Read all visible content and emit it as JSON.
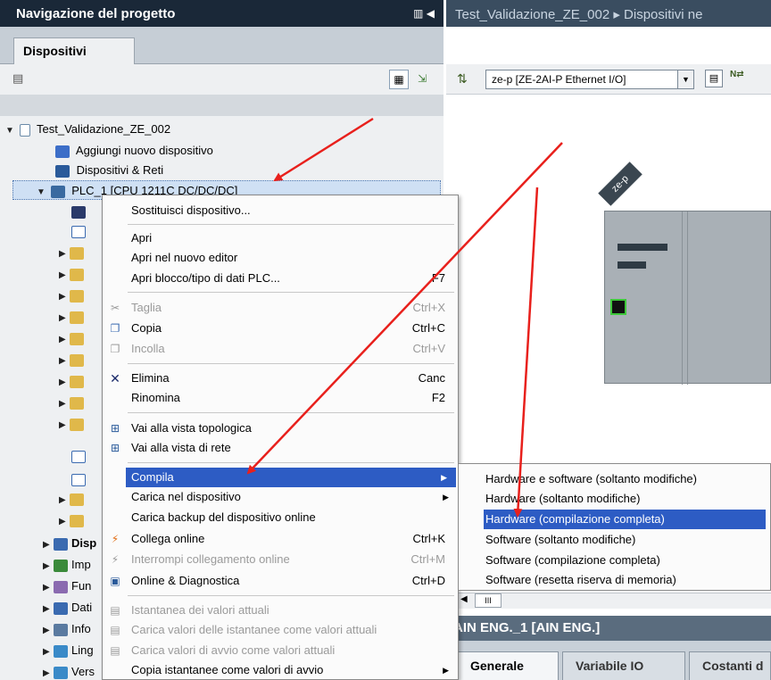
{
  "nav": {
    "title": "Navigazione del progetto",
    "tab": "Dispositivi"
  },
  "tree": {
    "project": "Test_Validazione_ZE_002",
    "add_device": "Aggiungi nuovo dispositivo",
    "devices_networks": "Dispositivi & Reti",
    "plc": "PLC_1 [CPU 1211C DC/DC/DC]",
    "bottom_items": [
      "Disp",
      "Imp",
      "Fun",
      "Dati",
      "Info",
      "Ling",
      "Vers"
    ]
  },
  "editor": {
    "breadcrumb": "Test_Validazione_ZE_002 ▸ Dispositivi ne",
    "device_select": "ze-p [ZE-2AI-P Ethernet I/O]",
    "device_tag": "ze-p",
    "scroll_mark": "III",
    "inspector_title": "AIN ENG._1 [AIN ENG.]",
    "inspector_tabs": [
      "Generale",
      "Variabile IO",
      "Costanti d"
    ]
  },
  "context_menu": {
    "items": [
      {
        "label": "Sostituisci dispositivo...",
        "key": "",
        "disabled": false
      },
      {
        "label": "Apri",
        "key": "",
        "disabled": false
      },
      {
        "label": "Apri nel nuovo editor",
        "key": "",
        "disabled": false
      },
      {
        "label": "Apri blocco/tipo di dati PLC...",
        "key": "F7",
        "disabled": false
      },
      {
        "label": "Taglia",
        "key": "Ctrl+X",
        "disabled": true
      },
      {
        "label": "Copia",
        "key": "Ctrl+C",
        "disabled": false
      },
      {
        "label": "Incolla",
        "key": "Ctrl+V",
        "disabled": true
      },
      {
        "label": "Elimina",
        "key": "Canc",
        "disabled": false
      },
      {
        "label": "Rinomina",
        "key": "F2",
        "disabled": false
      },
      {
        "label": "Vai alla vista topologica",
        "key": "",
        "disabled": false
      },
      {
        "label": "Vai alla vista di rete",
        "key": "",
        "disabled": false
      },
      {
        "label": "Compila",
        "key": "",
        "disabled": false
      },
      {
        "label": "Carica nel dispositivo",
        "key": "",
        "disabled": false
      },
      {
        "label": "Carica backup del dispositivo online",
        "key": "",
        "disabled": false
      },
      {
        "label": "Collega online",
        "key": "Ctrl+K",
        "disabled": false
      },
      {
        "label": "Interrompi collegamento online",
        "key": "Ctrl+M",
        "disabled": true
      },
      {
        "label": "Online & Diagnostica",
        "key": "Ctrl+D",
        "disabled": false
      },
      {
        "label": "Istantanea dei valori attuali",
        "key": "",
        "disabled": true
      },
      {
        "label": "Carica valori delle istantanee come valori attuali",
        "key": "",
        "disabled": true
      },
      {
        "label": "Carica valori di avvio come valori attuali",
        "key": "",
        "disabled": true
      },
      {
        "label": "Copia istantanee come valori di avvio",
        "key": "",
        "disabled": false
      }
    ]
  },
  "compile_submenu": {
    "items": [
      "Hardware e software (soltanto modifiche)",
      "Hardware (soltanto modifiche)",
      "Hardware (compilazione completa)",
      "Software (soltanto modifiche)",
      "Software (compilazione completa)",
      "Software (resetta riserva di memoria)"
    ],
    "highlighted": "Hardware (compilazione completa)"
  },
  "colors": {
    "title_bg": "#1a2838",
    "menu_highlight": "#2d5cc4",
    "annotation_arrow": "#e8201c"
  }
}
